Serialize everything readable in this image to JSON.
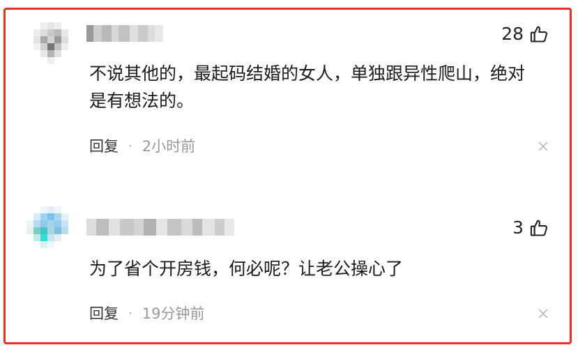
{
  "comments": [
    {
      "likes": "28",
      "text": "不说其他的，最起码结婚的女人，单独跟异性爬山，绝对是有想法的。",
      "reply_label": "回复",
      "separator": "·",
      "time": "2小时前"
    },
    {
      "likes": "3",
      "text": "为了省个开房钱，何必呢？让老公操心了",
      "reply_label": "回复",
      "separator": "·",
      "time": "19分钟前"
    }
  ],
  "icons": {
    "like": "thumbs-up-icon",
    "close": "close-icon"
  },
  "colors": {
    "border": "#ec2e24",
    "text": "#1a1a1a",
    "meta": "#999999"
  }
}
